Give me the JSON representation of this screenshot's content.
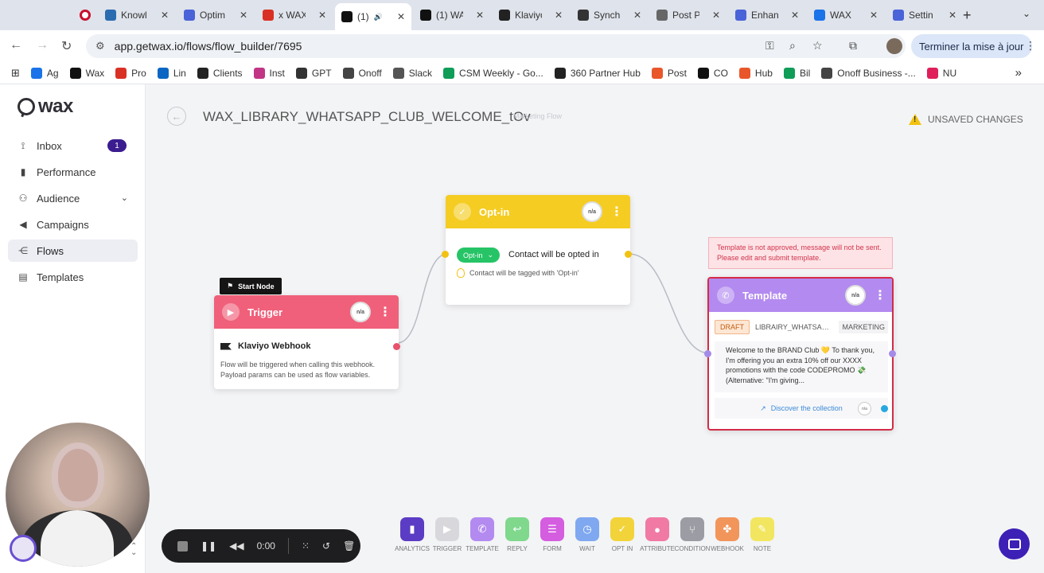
{
  "browser": {
    "tabs": [
      {
        "name": "",
        "color": "#c8102e",
        "icon": "record-icon"
      },
      {
        "name": "Knowl",
        "color": "#2b6cb0",
        "icon": "intercom-icon"
      },
      {
        "name": "Optim",
        "color": "#4a63d8",
        "icon": "gear-icon"
      },
      {
        "name": "x WAX",
        "color": "#d93025",
        "icon": "gmail-icon"
      },
      {
        "name": "(1)",
        "color": "#111111",
        "icon": "wax-icon",
        "active": true
      },
      {
        "name": "(1) WA",
        "color": "#111111",
        "icon": "wax-icon"
      },
      {
        "name": "Klaviyo",
        "color": "#222222",
        "icon": "klaviyo-icon"
      },
      {
        "name": "Synch",
        "color": "#333333",
        "icon": "openai-icon"
      },
      {
        "name": "Post P",
        "color": "#666666",
        "icon": "doc-icon"
      },
      {
        "name": "Enhan",
        "color": "#4a63d8",
        "icon": "gear-icon"
      },
      {
        "name": "WAX",
        "color": "#1a73e8",
        "icon": "calendar-icon"
      },
      {
        "name": "Settin",
        "color": "#4a63d8",
        "icon": "gear-icon"
      }
    ],
    "url": "app.getwax.io/flows/flow_builder/7695",
    "update_label": "Terminer la mise à jour",
    "bookmarks": [
      {
        "label": "Ag",
        "color": "#1a73e8"
      },
      {
        "label": "Wax",
        "color": "#111111"
      },
      {
        "label": "Pro",
        "color": "#d93025"
      },
      {
        "label": "Lin",
        "color": "#0a66c2"
      },
      {
        "label": "Clients",
        "color": "#222222"
      },
      {
        "label": "Inst",
        "color": "#c13584"
      },
      {
        "label": "GPT",
        "color": "#333333"
      },
      {
        "label": "Onoff",
        "color": "#444444"
      },
      {
        "label": "Slack",
        "color": "#555555"
      },
      {
        "label": "CSM Weekly - Go...",
        "color": "#0f9d58"
      },
      {
        "label": "360 Partner Hub",
        "color": "#222222"
      },
      {
        "label": "Post",
        "color": "#e8562a"
      },
      {
        "label": "CO",
        "color": "#111111"
      },
      {
        "label": "Hub",
        "color": "#e8562a"
      },
      {
        "label": "Bil",
        "color": "#0f9d58"
      },
      {
        "label": "Onoff Business -...",
        "color": "#444444"
      },
      {
        "label": "NU",
        "color": "#e01e5a"
      }
    ]
  },
  "sidebar": {
    "logo": "wax",
    "items": [
      {
        "label": "Inbox",
        "icon": "inbox-icon",
        "badge": "1"
      },
      {
        "label": "Performance",
        "icon": "bar-chart-icon"
      },
      {
        "label": "Audience",
        "icon": "users-icon",
        "expandable": true
      },
      {
        "label": "Campaigns",
        "icon": "megaphone-icon"
      },
      {
        "label": "Flows",
        "icon": "flow-icon",
        "active": true
      },
      {
        "label": "Templates",
        "icon": "template-icon"
      }
    ]
  },
  "header": {
    "title": "WAX_LIBRARY_WHATSAPP_CLUB_WELCOME_tOv",
    "type": "Marketing Flow",
    "unsaved": "UNSAVED CHANGES"
  },
  "nodes": {
    "start_tag": "Start Node",
    "trigger": {
      "title": "Trigger",
      "na": "n/a",
      "source": "Klaviyo Webhook",
      "description": "Flow will be triggered when calling this webhook. Payload params can be used as flow variables."
    },
    "optin": {
      "title": "Opt-in",
      "na": "n/a",
      "pill": "Opt-in",
      "text": "Contact will be opted in",
      "sub": "Contact will be tagged with 'Opt-in'"
    },
    "template": {
      "warning": "Template is not approved, message will not be sent. Please edit and submit template.",
      "title": "Template",
      "na": "n/a",
      "status": "DRAFT",
      "name": "LIBRAIRY_WHATSAPP...",
      "category": "MARKETING",
      "body": "Welcome to the BRAND Club 💛 To thank you, I'm offering you an extra 10% off our XXXX promotions with the code CODEPROMO 💸 (Alternative: \"I'm giving...",
      "button": "Discover the collection",
      "button_na": "n/a"
    }
  },
  "toolbar": [
    {
      "label": "ANALYTICS",
      "color": "#5b3cc4",
      "icon": "bar-chart-icon"
    },
    {
      "label": "TRIGGER",
      "color": "#d8d8dc",
      "icon": "play-icon"
    },
    {
      "label": "TEMPLATE",
      "color": "#b38af0",
      "icon": "whatsapp-icon"
    },
    {
      "label": "REPLY",
      "color": "#7fd88c",
      "icon": "reply-icon"
    },
    {
      "label": "FORM",
      "color": "#d45de0",
      "icon": "form-icon"
    },
    {
      "label": "WAIT",
      "color": "#7fa8f0",
      "icon": "clock-icon"
    },
    {
      "label": "OPT IN",
      "color": "#f2d33a",
      "icon": "check-icon"
    },
    {
      "label": "ATTRIBUTE",
      "color": "#f07aa3",
      "icon": "user-icon"
    },
    {
      "label": "CONDITION",
      "color": "#9c9ca4",
      "icon": "split-icon"
    },
    {
      "label": "WEBHOOK",
      "color": "#f2955a",
      "icon": "webhook-icon"
    },
    {
      "label": "NOTE",
      "color": "#f2e660",
      "icon": "note-icon"
    }
  ],
  "recorder": {
    "time": "0:00"
  },
  "colors": {
    "trigger": "#f0607a",
    "optin": "#f5cc22",
    "template": "#b38af0",
    "error": "#d42b47",
    "accent": "#3d20b5"
  }
}
